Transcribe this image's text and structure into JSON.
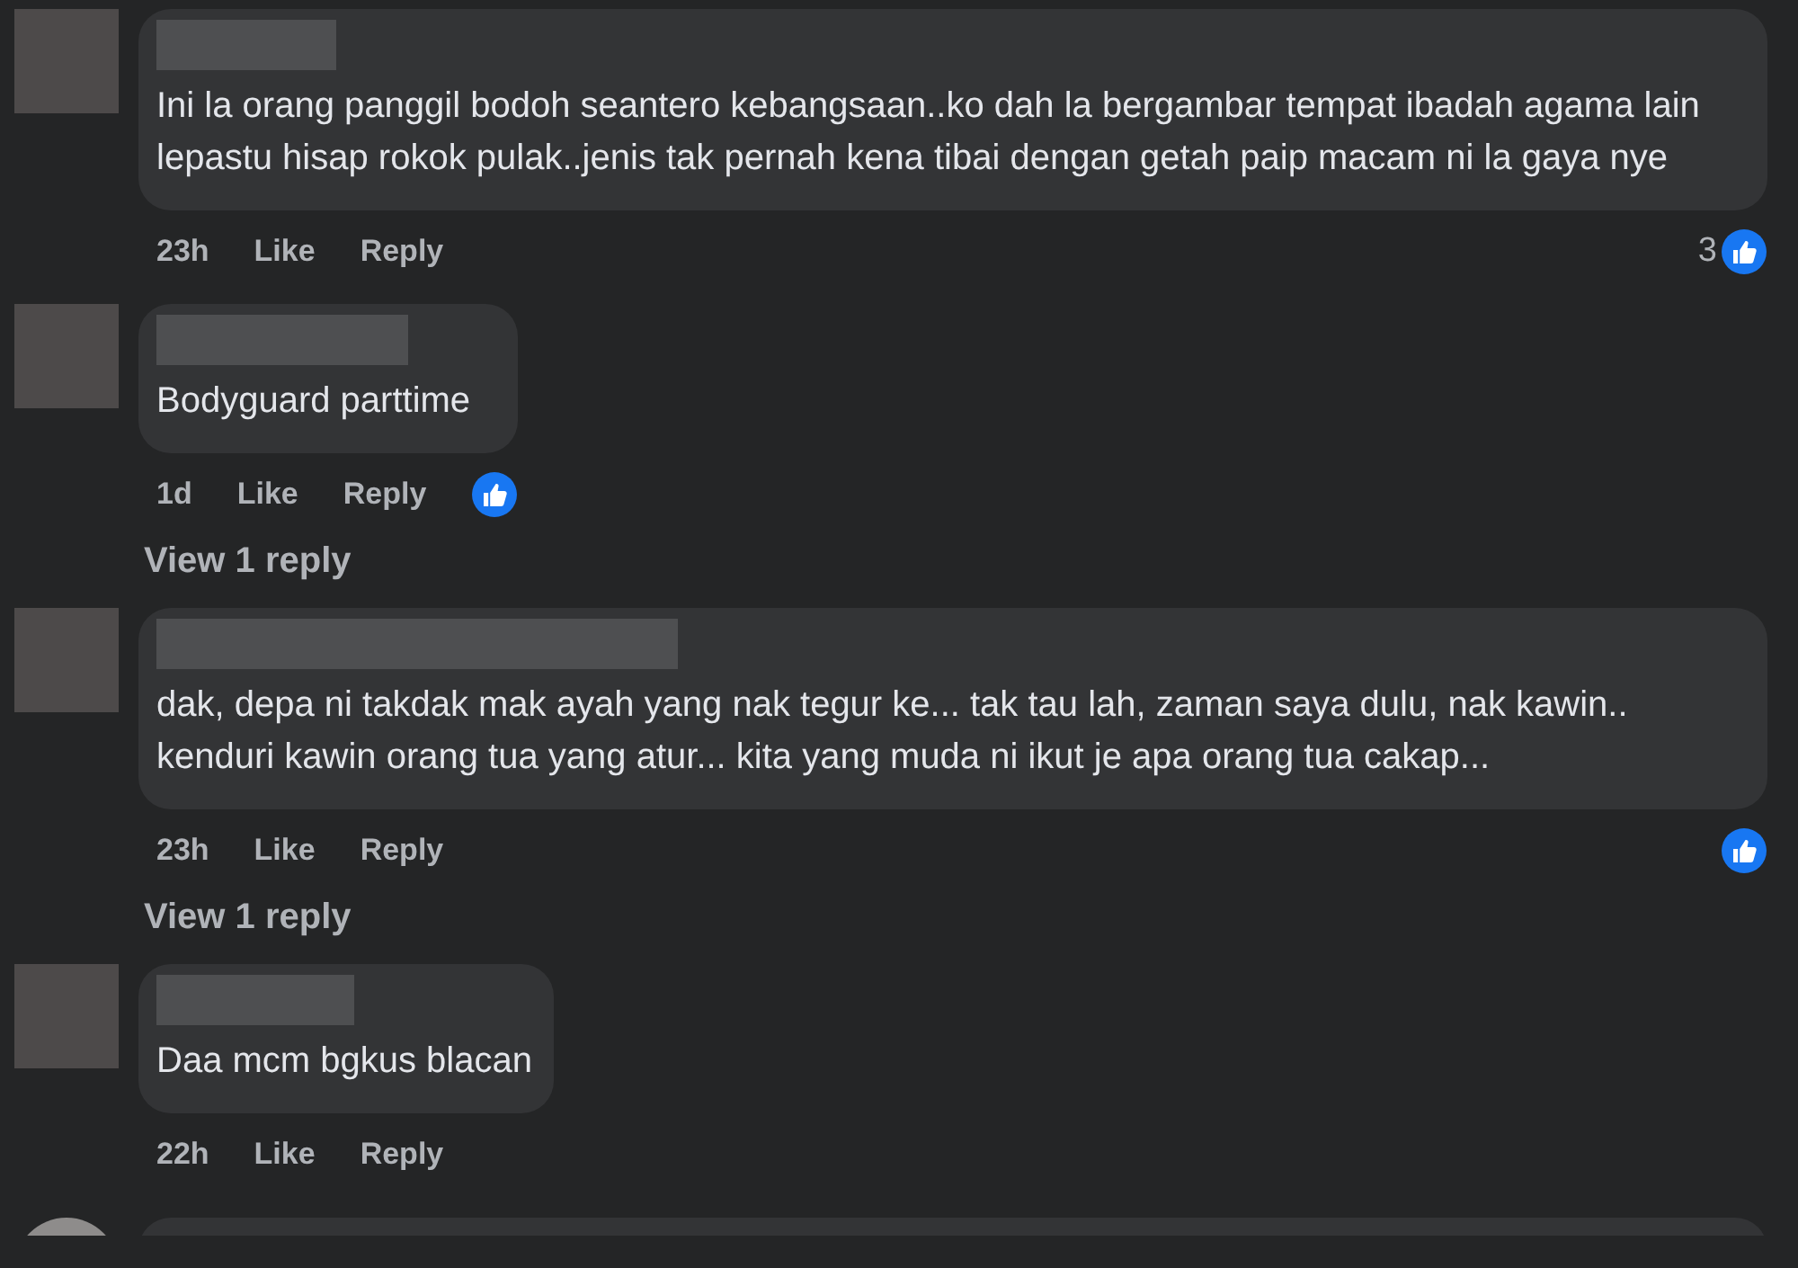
{
  "comments": [
    {
      "text": "Ini la orang panggil bodoh seantero kebangsaan..ko dah la bergambar tempat ibadah agama lain lepastu hisap rokok pulak..jenis tak pernah kena tibai dengan getah paip macam ni la gaya nye",
      "time": "23h",
      "like_label": "Like",
      "reply_label": "Reply",
      "reacted": true,
      "reaction_count": "3"
    },
    {
      "text": "Bodyguard parttime",
      "time": "1d",
      "like_label": "Like",
      "reply_label": "Reply",
      "reacted": true,
      "view_replies": "View 1 reply"
    },
    {
      "text": "dak, depa ni takdak mak ayah yang nak tegur ke... tak tau lah, zaman saya dulu, nak kawin.. kenduri kawin orang tua yang atur... kita yang muda ni ikut je apa orang tua cakap...",
      "time": "23h",
      "like_label": "Like",
      "reply_label": "Reply",
      "reacted": true,
      "view_replies": "View 1 reply"
    },
    {
      "text": "Daa mcm bgkus blacan",
      "time": "22h",
      "like_label": "Like",
      "reply_label": "Reply",
      "reacted": false
    }
  ],
  "more_below": true
}
